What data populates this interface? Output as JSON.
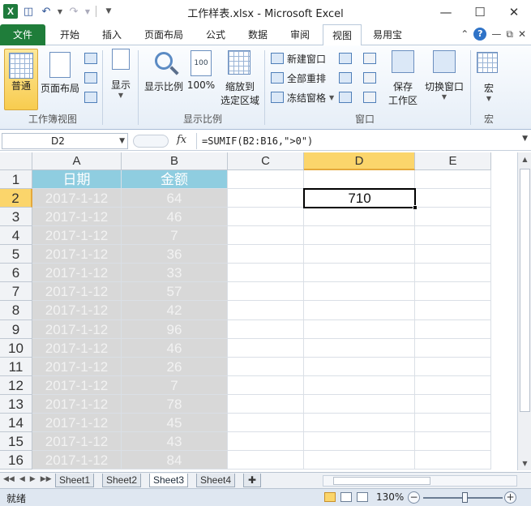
{
  "window": {
    "title": "工作样表.xlsx - Microsoft Excel",
    "app_icon_letter": "X"
  },
  "tabs": [
    {
      "label": "文件"
    },
    {
      "label": "开始"
    },
    {
      "label": "插入"
    },
    {
      "label": "页面布局"
    },
    {
      "label": "公式"
    },
    {
      "label": "数据"
    },
    {
      "label": "审阅"
    },
    {
      "label": "视图"
    },
    {
      "label": "易用宝"
    }
  ],
  "ribbon": {
    "normal": "普通",
    "page_layout": "页面布局",
    "show": "显示",
    "zoom": "显示比例",
    "zoom100": "100%",
    "zoom_selection_1": "缩放到",
    "zoom_selection_2": "选定区域",
    "new_window": "新建窗口",
    "arrange_all": "全部重排",
    "freeze_panes": "冻结窗格",
    "save_workspace_1": "保存",
    "save_workspace_2": "工作区",
    "switch_windows": "切换窗口",
    "macros": "宏",
    "group_workbook_views": "工作簿视图",
    "group_zoom": "显示比例",
    "group_window": "窗口",
    "group_macros": "宏",
    "hundred_icon_text": "100"
  },
  "formula_bar": {
    "name_box": "D2",
    "fx": "fx",
    "formula": "=SUMIF(B2:B16,\">0\")"
  },
  "grid": {
    "columns": [
      "A",
      "B",
      "C",
      "D",
      "E"
    ],
    "rows": [
      "1",
      "2",
      "3",
      "4",
      "5",
      "6",
      "7",
      "8",
      "9",
      "10",
      "11",
      "12",
      "13",
      "14",
      "15",
      "16"
    ],
    "header": {
      "a": "日期",
      "b": "金额"
    },
    "data": [
      {
        "date": "2017-1-12",
        "amount": "64"
      },
      {
        "date": "2017-1-12",
        "amount": "46"
      },
      {
        "date": "2017-1-12",
        "amount": "7"
      },
      {
        "date": "2017-1-12",
        "amount": "36"
      },
      {
        "date": "2017-1-12",
        "amount": "33"
      },
      {
        "date": "2017-1-12",
        "amount": "57"
      },
      {
        "date": "2017-1-12",
        "amount": "42"
      },
      {
        "date": "2017-1-12",
        "amount": "96"
      },
      {
        "date": "2017-1-12",
        "amount": "46"
      },
      {
        "date": "2017-1-12",
        "amount": "26"
      },
      {
        "date": "2017-1-12",
        "amount": "7"
      },
      {
        "date": "2017-1-12",
        "amount": "78"
      },
      {
        "date": "2017-1-12",
        "amount": "45"
      },
      {
        "date": "2017-1-12",
        "amount": "43"
      },
      {
        "date": "2017-1-12",
        "amount": "84"
      }
    ],
    "d2_value": "710"
  },
  "sheets": [
    {
      "label": "Sheet1"
    },
    {
      "label": "Sheet2"
    },
    {
      "label": "Sheet3"
    },
    {
      "label": "Sheet4"
    }
  ],
  "status": {
    "ready": "就绪",
    "zoom": "130%"
  },
  "colors": {
    "header_fill": "#8fcde0",
    "shade_fill": "#d8d8d8",
    "file_tab": "#1f7d3a",
    "selection_highlight": "#fbd56b"
  }
}
